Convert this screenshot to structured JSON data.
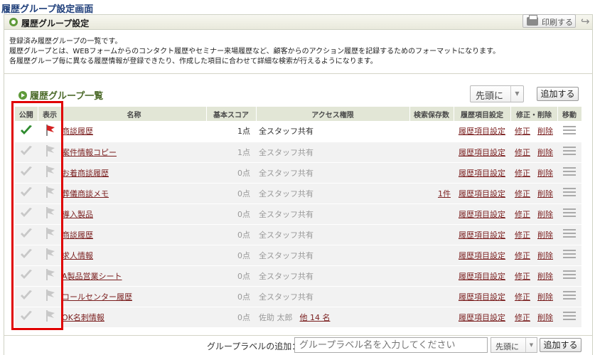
{
  "page_title": "履歴グループ設定画面",
  "panel_title": "履歴グループ設定",
  "print_label": "印刷する",
  "description": [
    "登録済み履歴グループの一覧です。",
    "履歴グループとは、WEBフォームからのコンタクト履歴やセミナー来場履歴など、顧客からのアクション履歴を記録するためのフォーマットになります。",
    "各履歴グループ毎に異なる履歴情報が登録できたり、作成した項目に合わせて詳細な検索が行えるようになります。"
  ],
  "list_title": "履歴グループ一覧",
  "sort_select": {
    "value": "先頭に"
  },
  "add_label": "追加する",
  "columns": {
    "pub": "公開",
    "show": "表示",
    "name": "名称",
    "score": "基本スコア",
    "access": "アクセス権限",
    "count": "検索保存数",
    "settings": "履歴項目設定",
    "edit": "修正・削除",
    "move": "移動"
  },
  "rows": [
    {
      "name": "商談履歴",
      "score": "1点",
      "access": "全スタッフ共有",
      "access_more": "",
      "count": "",
      "settings": "履歴項目設定",
      "edit": "修正",
      "delete": "削除",
      "active": true
    },
    {
      "name": "案件情報コピー",
      "score": "1点",
      "access": "全スタッフ共有",
      "access_more": "",
      "count": "",
      "settings": "履歴項目設定",
      "edit": "修正",
      "delete": "削除",
      "active": false
    },
    {
      "name": "お着商談履歴",
      "score": "0点",
      "access": "全スタッフ共有",
      "access_more": "",
      "count": "",
      "settings": "履歴項目設定",
      "edit": "修正",
      "delete": "削除",
      "active": false
    },
    {
      "name": "葬儀商談メモ",
      "score": "0点",
      "access": "全スタッフ共有",
      "access_more": "",
      "count": "1件",
      "settings": "履歴項目設定",
      "edit": "修正",
      "delete": "削除",
      "active": false
    },
    {
      "name": "導入製品",
      "score": "0点",
      "access": "全スタッフ共有",
      "access_more": "",
      "count": "",
      "settings": "履歴項目設定",
      "edit": "修正",
      "delete": "削除",
      "active": false
    },
    {
      "name": "商談履歴",
      "score": "0点",
      "access": "全スタッフ共有",
      "access_more": "",
      "count": "",
      "settings": "履歴項目設定",
      "edit": "修正",
      "delete": "削除",
      "active": false
    },
    {
      "name": "求人情報",
      "score": "0点",
      "access": "全スタッフ共有",
      "access_more": "",
      "count": "",
      "settings": "履歴項目設定",
      "edit": "修正",
      "delete": "削除",
      "active": false
    },
    {
      "name": "A製品営業シート",
      "score": "0点",
      "access": "全スタッフ共有",
      "access_more": "",
      "count": "",
      "settings": "履歴項目設定",
      "edit": "修正",
      "delete": "削除",
      "active": false
    },
    {
      "name": "コールセンター履歴",
      "score": "0点",
      "access": "全スタッフ共有",
      "access_more": "",
      "count": "",
      "settings": "履歴項目設定",
      "edit": "修正",
      "delete": "削除",
      "active": false
    },
    {
      "name": "OK名刺情報",
      "score": "0点",
      "access": "佐助 太郎",
      "access_more": "他 14 名",
      "count": "",
      "settings": "履歴項目設定",
      "edit": "修正",
      "delete": "削除",
      "active": false
    }
  ],
  "footer": {
    "label": "グループラベルの追加：",
    "input_placeholder": "グループラベル名を入力してください",
    "select_value": "先頭に",
    "add_label": "追加する"
  },
  "colors": {
    "check_active": "#2e8b2e",
    "flag_active": "#d42020",
    "inactive_icon": "#c8c8c8",
    "highlight_box": "#e00000",
    "link": "#7a1e1e"
  }
}
